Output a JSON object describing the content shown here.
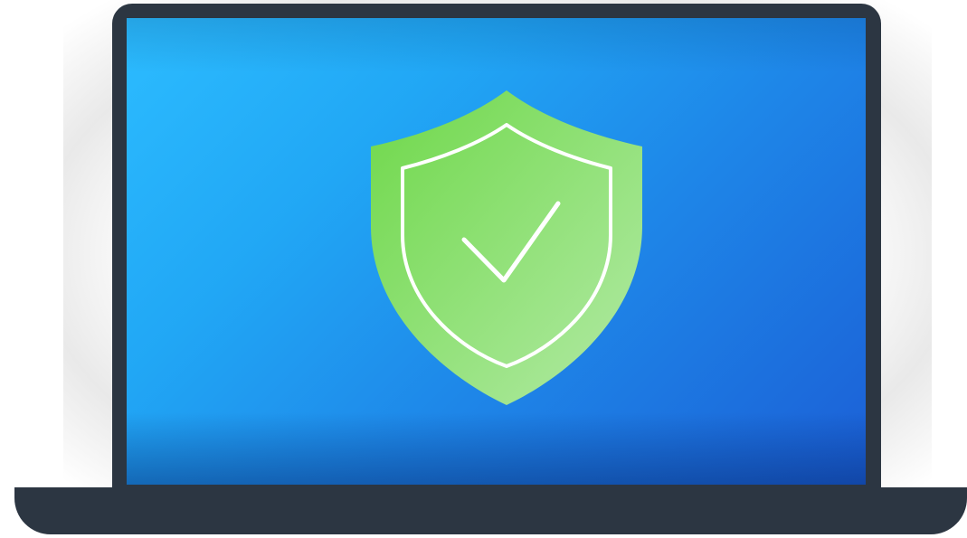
{
  "illustration": {
    "shield_icon": "shield-check-icon",
    "colors": {
      "laptop_frame": "#2c3642",
      "screen_light": "#2cbcff",
      "screen_dark": "#1b5fd6",
      "shield_light": "#a8e89a",
      "shield_dark": "#6fd84a",
      "outline": "#ffffff"
    }
  }
}
